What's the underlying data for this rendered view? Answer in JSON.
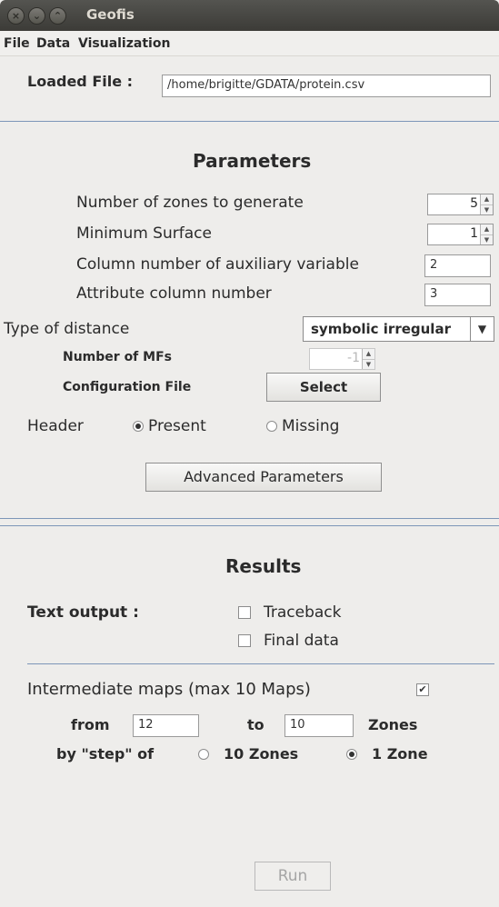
{
  "window": {
    "title": "Geofis"
  },
  "menu": {
    "file": "File",
    "data": "Data",
    "visualization": "Visualization"
  },
  "loaded_file": {
    "label": "Loaded File :",
    "value": "/home/brigitte/GDATA/protein.csv"
  },
  "parameters": {
    "title": "Parameters",
    "zones_label": "Number of zones to generate",
    "zones_value": "5",
    "min_surface_label": "Minimum Surface",
    "min_surface_value": "1",
    "aux_col_label": "Column number of auxiliary variable",
    "aux_col_value": "2",
    "attr_col_label": "Attribute column number",
    "attr_col_value": "3",
    "distance_label": "Type of distance",
    "distance_value": "symbolic irregular",
    "mfs_label": "Number of MFs",
    "mfs_value": "-1",
    "config_label": "Configuration File",
    "select_label": "Select",
    "header_label": "Header",
    "present_label": "Present",
    "missing_label": "Missing",
    "header_selected": "Present",
    "advanced_label": "Advanced Parameters"
  },
  "results": {
    "title": "Results",
    "text_output_label": "Text output :",
    "traceback_label": "Traceback",
    "traceback_checked": false,
    "final_data_label": "Final data",
    "final_data_checked": false,
    "intermediate_label": "Intermediate maps (max 10 Maps)",
    "intermediate_checked": true,
    "from_label": "from",
    "from_value": "12",
    "to_label": "to",
    "to_value": "10",
    "zones_label": "Zones",
    "step_label": "by \"step\" of",
    "step10_label": "10 Zones",
    "step1_label": "1 Zone",
    "step_selected": "1 Zone",
    "run_label": "Run"
  },
  "icons": {
    "close": "close-icon",
    "minimize": "minimize-icon",
    "maximize": "maximize-icon",
    "dropdown": "chevron-down-icon"
  }
}
